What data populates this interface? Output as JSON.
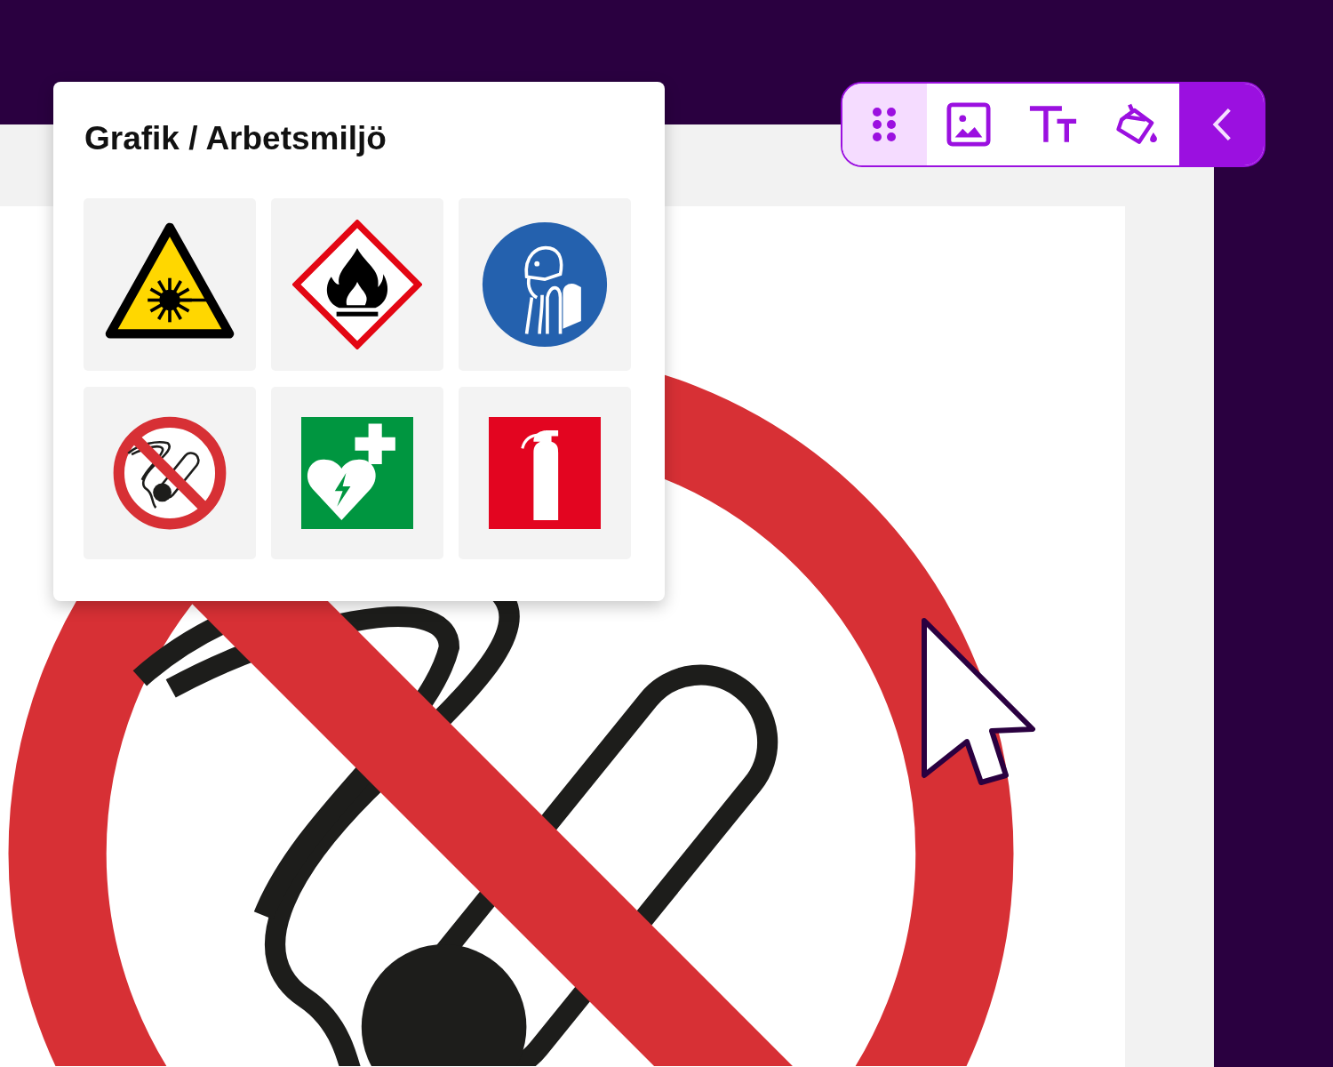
{
  "panel": {
    "title": "Grafik / Arbetsmiljö",
    "signs": [
      {
        "kind": "laser"
      },
      {
        "kind": "flammable"
      },
      {
        "kind": "breathing"
      },
      {
        "kind": "no-smoking"
      },
      {
        "kind": "defibrillator"
      },
      {
        "kind": "extinguisher"
      }
    ]
  },
  "toolbar": {
    "tools": [
      {
        "kind": "handle"
      },
      {
        "kind": "image"
      },
      {
        "kind": "text"
      },
      {
        "kind": "fill"
      },
      {
        "kind": "collapse"
      }
    ]
  },
  "canvas": {
    "sign": {
      "kind": "no-smoking"
    }
  }
}
